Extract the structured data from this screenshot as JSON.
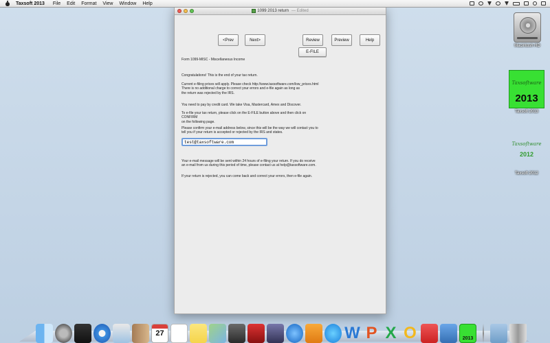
{
  "menubar": {
    "app_name": "Taxsoft 2013",
    "items": [
      "File",
      "Edit",
      "Format",
      "View",
      "Window",
      "Help"
    ]
  },
  "window": {
    "title": "1099 2013 return",
    "edited_label": "— Edited"
  },
  "buttons": {
    "prev": "<Prev",
    "next": "Next>",
    "review": "Review",
    "preview": "Preview",
    "help": "Help",
    "efile": "E-FILE"
  },
  "form": {
    "form_title": "Form 1099-MISC - Miscellaneous Income",
    "congrats": "Congratulations! This is the end of your tax return.",
    "prices_line1": "Current e-filing prices will apply.  Please check http://www.taxsoftware.com/low_prices.html",
    "prices_line2": "There is no additional charge to correct your errors and e-file again as long as",
    "prices_line3": "the return was rejected by the IRS.",
    "credit": "You need to pay by credit card.  We take Visa, Mastercard, Amex and Discover.",
    "efile_line1": "To e-file your tax return, please click on the E-FILE button above and then click on CONFIRM",
    "efile_line2": "on the following page.",
    "confirm_line1": "Please confirm your e-mail address below, since this will be the way we will contact you to",
    "confirm_line2": "tell you if your return is accepted or rejected by the IRS and states.",
    "email_value": "test@taxsoftware.com",
    "message_line1": "Your e-mail message will be sent within 24 hours of e-filing your return.  If you do receive",
    "message_line2": "an e-mail from us during this period of time, please contact us at help@taxsoftware.com.",
    "rejected": "If your return is rejected, you can come back and correct your errors, then e-file again."
  },
  "desktop_icons": {
    "hd_label": "Macintosh HD",
    "ts2013_label": "Taxsoft 2013",
    "ts2013_year": "2013",
    "ts2013_logo": "Taxsoftware",
    "ts2012_label": "Taxsoft 2012",
    "ts2012_year": "2012",
    "ts2012_logo": "Taxsoftware"
  },
  "dock": {
    "calendar_day": "27",
    "word_letter": "W",
    "ppt_letter": "P",
    "excel_letter": "X",
    "outlook_letter": "O",
    "taxsoft_label": "2013"
  },
  "colors": {
    "taxsoft_green": "#38e033",
    "input_focus_blue": "#6e9ddc"
  }
}
